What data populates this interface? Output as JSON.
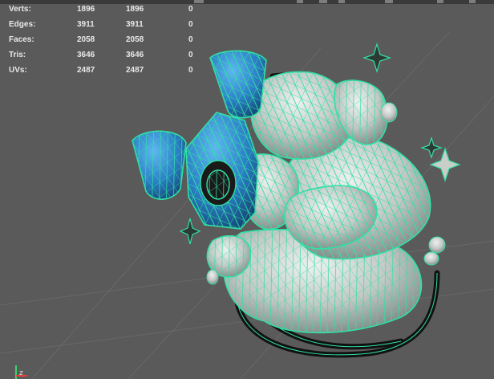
{
  "viewport": {
    "background": "#5a5a5a",
    "grid_color": "#6a6a6a",
    "wire_color": "#31e0a6",
    "mesh_color": "#c8cdca",
    "selected_color": "#2a7fc4"
  },
  "hud_stats": [
    {
      "label": "Verts:",
      "col1": "1896",
      "col2": "1896",
      "col3": "0"
    },
    {
      "label": "Edges:",
      "col1": "3911",
      "col2": "3911",
      "col3": "0"
    },
    {
      "label": "Faces:",
      "col1": "2058",
      "col2": "2058",
      "col3": "0"
    },
    {
      "label": "Tris:",
      "col1": "3646",
      "col2": "3646",
      "col3": "0"
    },
    {
      "label": "UVs:",
      "col1": "2487",
      "col2": "2487",
      "col3": "0"
    }
  ],
  "axis_gizmo": {
    "label": "z"
  }
}
